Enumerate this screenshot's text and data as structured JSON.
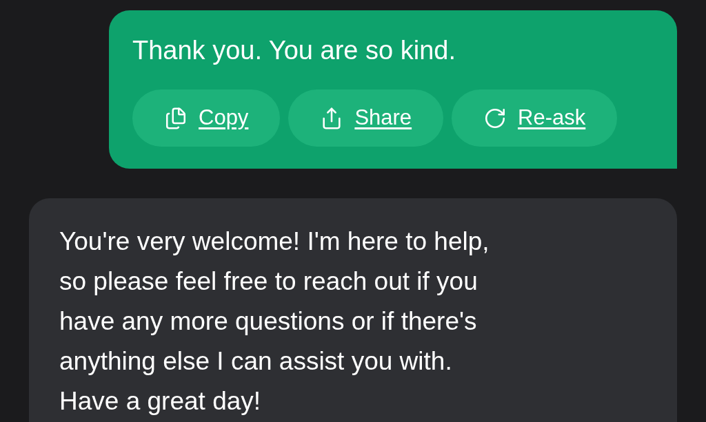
{
  "user_message": {
    "text": "Thank you. You are so kind.",
    "actions": [
      {
        "kind": "copy",
        "label": "Copy"
      },
      {
        "kind": "share",
        "label": "Share"
      },
      {
        "kind": "reask",
        "label": "Re-ask"
      }
    ]
  },
  "assistant_message": {
    "text": "You're very welcome! I'm here to help,\nso please feel free to reach out if you\nhave any more questions or if there's\nanything else I can assist you with.\nHave a great day!"
  }
}
